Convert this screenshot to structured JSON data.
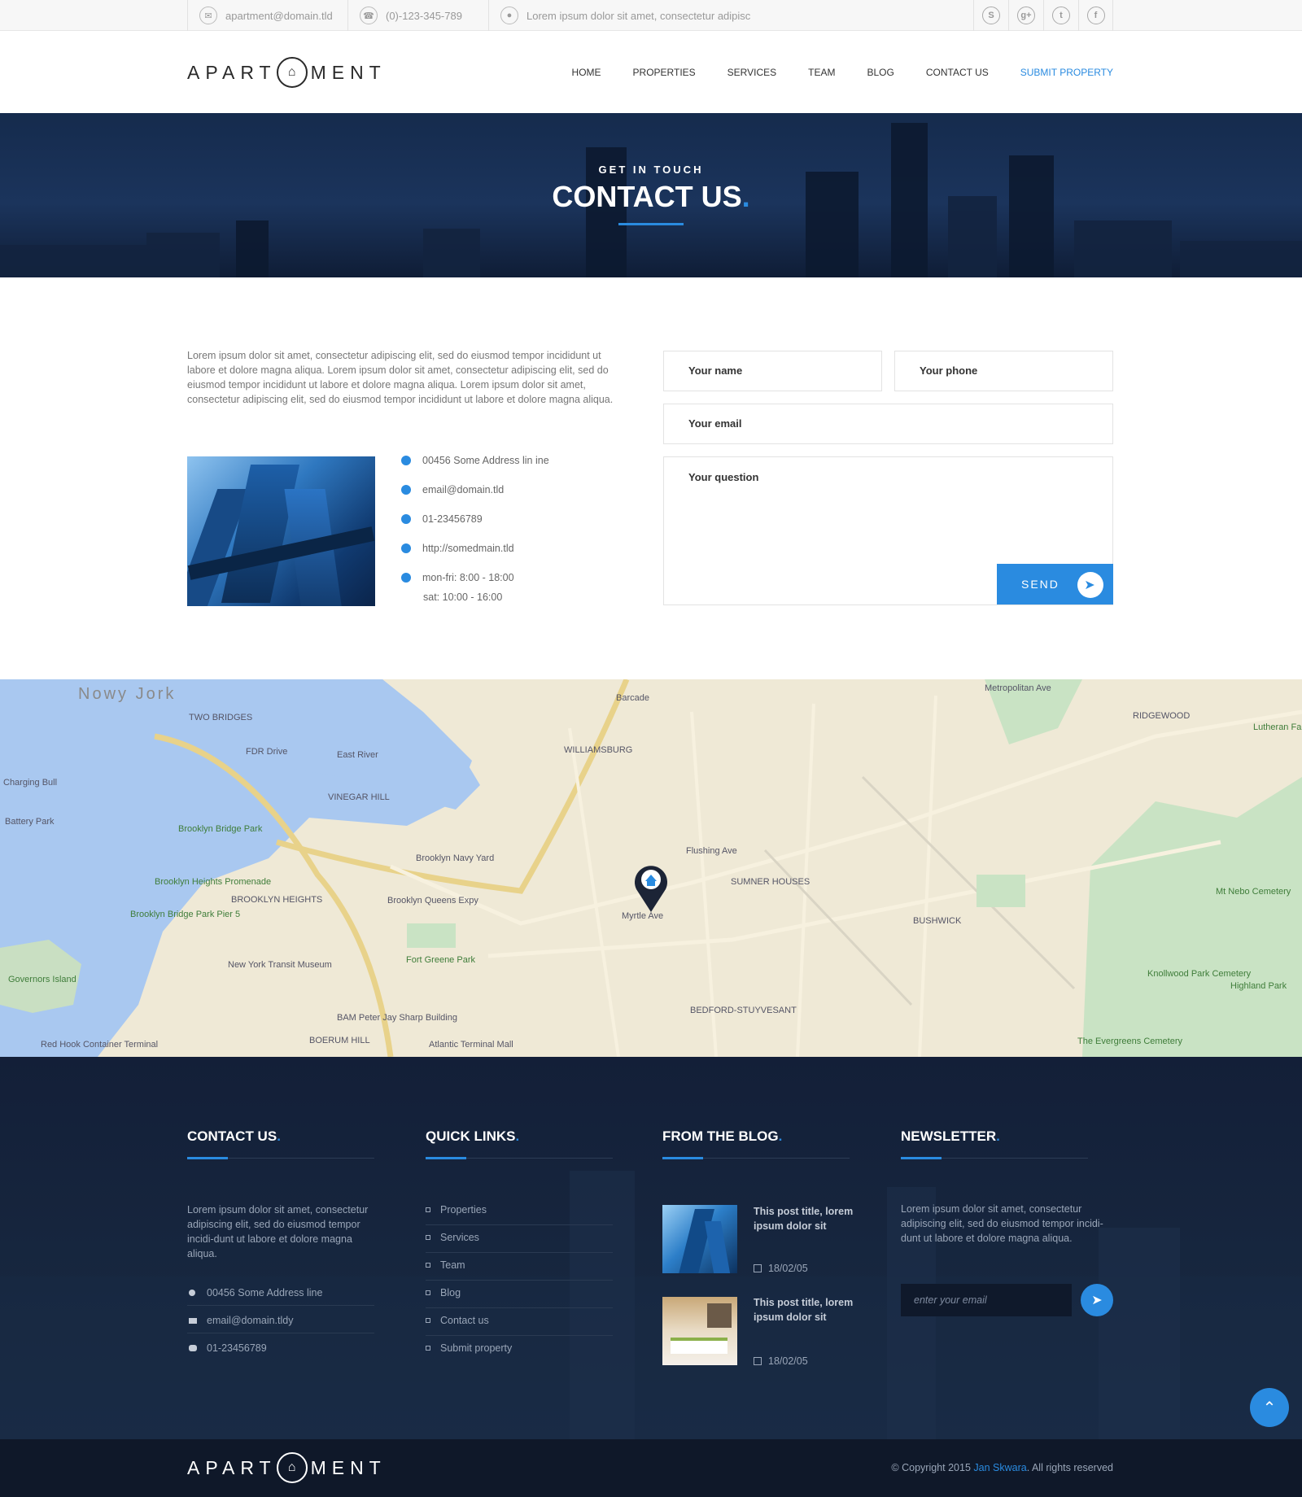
{
  "topbar": {
    "email": "apartment@domain.tld",
    "phone": "(0)-123-345-789",
    "address": "Lorem ipsum dolor sit amet, consectetur adipisc",
    "social": [
      "skype-icon",
      "google-plus-icon",
      "twitter-icon",
      "facebook-icon"
    ]
  },
  "header": {
    "logo_left": "APART",
    "logo_right": "MENT",
    "nav": [
      "HOME",
      "PROPERTIES",
      "SERVICES",
      "TEAM",
      "BLOG",
      "CONTACT US",
      "SUBMIT PROPERTY"
    ]
  },
  "hero": {
    "eyebrow": "GET IN TOUCH",
    "title": "CONTACT US",
    "title_dot": "."
  },
  "contact": {
    "intro": "Lorem ipsum dolor sit amet, consectetur adipiscing elit, sed do eiusmod tempor incididunt ut labore et dolore magna aliqua. Lorem ipsum dolor sit amet, consectetur adipiscing elit, sed do eiusmod tempor incididunt ut labore et dolore magna aliqua. Lorem ipsum dolor sit amet, consectetur adipiscing elit, sed do eiusmod tempor incididunt ut labore et dolore magna aliqua.",
    "address": "00456 Some Address lin ine",
    "email": "email@domain.tld",
    "phone": "01-23456789",
    "website": "http://somedmain.tld",
    "hours_week": "mon-fri: 8:00 - 18:00",
    "hours_sat": "sat:        10:00 - 16:00"
  },
  "form": {
    "name_placeholder": "Your name",
    "phone_placeholder": "Your phone",
    "email_placeholder": "Your email",
    "question_placeholder": "Your question",
    "send_label": "SEND"
  },
  "map": {
    "labels": [
      "Nowy Jork",
      "TWO BRIDGES",
      "East River",
      "WILLIAMSBURG",
      "VINEGAR HILL",
      "Brooklyn Navy Yard",
      "Brooklyn Bridge Park",
      "Brooklyn Heights Promenade",
      "BROOKLYN HEIGHTS",
      "Fort Greene Park",
      "SUMNER HOUSES",
      "BUSHWICK",
      "BEDFORD-STUYVESANT",
      "RIDGEWOOD",
      "Knollwood Park Cemetery",
      "Highland Park",
      "The Evergreens Cemetery",
      "Governors Island",
      "Red Hook Container Terminal",
      "New York Transit Museum",
      "BAM Peter Jay Sharp Building",
      "BOERUM HILL",
      "Atlantic Terminal Mall",
      "Mt Nebo Cemetery",
      "Brooklyn Bridge Park Pier 5",
      "Charging Bull",
      "Battery Park",
      "Barcade",
      "Myrtle Ave",
      "Flushing Ave",
      "Brooklyn Queens Expy",
      "FDR Drive",
      "Metropolitan Ave",
      "Lutheran Faiths Cemetery"
    ]
  },
  "footer": {
    "contact_title": "CONTACT US",
    "contact_text": "Lorem ipsum dolor sit amet, consectetur adipiscing elit, sed do eiusmod tempor incidi-dunt ut labore et dolore magna aliqua.",
    "contact_address": "00456 Some Address line",
    "contact_email": "email@domain.tldy",
    "contact_phone": "01-23456789",
    "links_title": "QUICK LINKS",
    "links": [
      "Properties",
      "Services",
      "Team",
      "Blog",
      "Contact us",
      "Submit property"
    ],
    "blog_title": "FROM THE BLOG",
    "posts": [
      {
        "title": "This post title, lorem ipsum dolor sit",
        "date": "18/02/05"
      },
      {
        "title": "This post title, lorem ipsum dolor sit",
        "date": "18/02/05"
      }
    ],
    "newsletter_title": "NEWSLETTER",
    "newsletter_text": "Lorem ipsum dolor sit amet, consectetur adipiscing elit, sed do eiusmod tempor incidi-dunt ut labore et dolore magna aliqua.",
    "newsletter_placeholder": "enter your email",
    "dot": "."
  },
  "bottom": {
    "logo_left": "APART",
    "logo_right": "MENT",
    "copyright_prefix": "Copyright 2015",
    "author": "Jan Skwara",
    "copyright_suffix": ". All rights reserved"
  },
  "colors": {
    "accent": "#2a8be0",
    "footer_bg": "#131f38",
    "map_bg": "#efe9d6",
    "water": "#a9c8f0"
  }
}
